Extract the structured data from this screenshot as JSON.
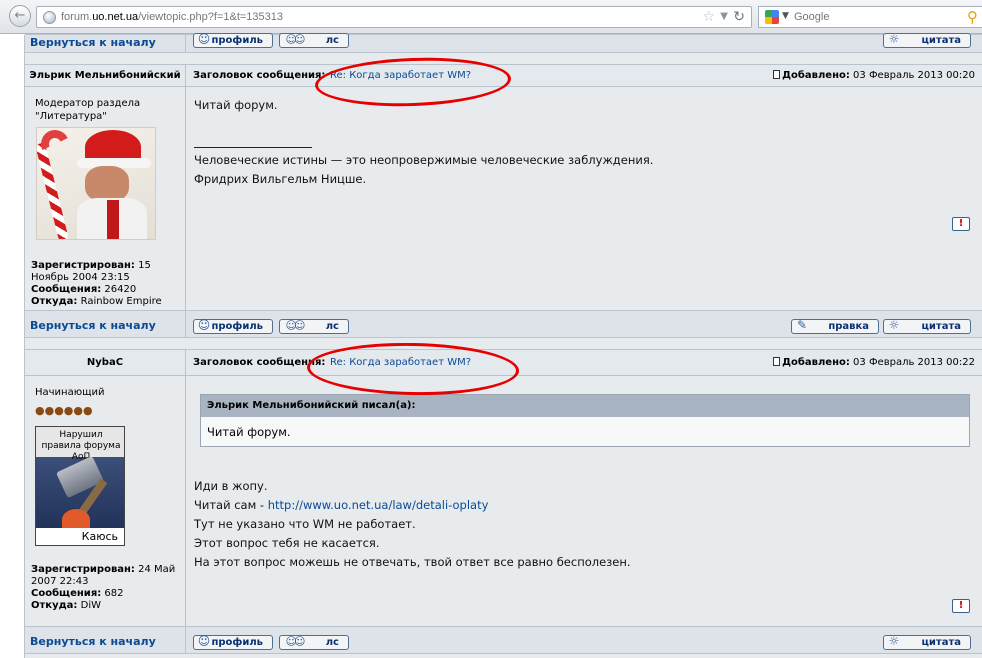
{
  "browser": {
    "url_prefix": "forum.",
    "url_domain": "uo.net.ua",
    "url_path": "/viewtopic.php?f=1&t=135313",
    "search_placeholder": "Google",
    "back_icon": "back-arrow-icon",
    "colors": {
      "chrome_top": "#f4f5f7",
      "chrome_bottom": "#dfe3e8"
    }
  },
  "nav": {
    "back_to_top": "Вернуться к началу"
  },
  "buttons": {
    "profile": "профиль",
    "pm": "лс",
    "quote": "цитата",
    "edit": "правка"
  },
  "labels": {
    "subject": "Заголовок сообщения:",
    "posted": "Добавлено:",
    "registered": "Зарегистрирован:",
    "posts": "Сообщения:",
    "from": "Откуда:",
    "quote_wrote": "Эльрик Мельнибонийский писал(а):"
  },
  "posts": [
    {
      "author": "Эльрик Мельнибонийский",
      "rank": [
        "Модератор раздела",
        "\"Литература\""
      ],
      "subject": "Re: Когда заработает WM?",
      "date": "03 Февраль 2013 00:20",
      "registered_1": "15",
      "registered_2": "Ноябрь 2004 23:15",
      "posts_count": "26420",
      "location": "Rainbow Empire",
      "body": [
        "Читай форум."
      ],
      "signature": [
        "Человеческие истины — это неопровержимые человеческие заблуждения.",
        "Фридрих Вильгельм Ницше."
      ]
    },
    {
      "author": "NybaC",
      "rank": [
        "Начинающий"
      ],
      "rank_stars": "●●●●●●",
      "avatar_caption": "Нарушил правила форума АоП",
      "avatar_bottom": "Каюсь",
      "subject": "Re: Когда заработает WM?",
      "date": "03 Февраль 2013 00:22",
      "registered_1": "24 Май",
      "registered_2": "2007 22:43",
      "posts_count": "682",
      "location": "DiW",
      "quote_text": "Читай форум.",
      "body": [
        "Иди в жопу.",
        "Читай сам - ",
        "Тут не указано что WM не работает.",
        "Этот вопрос тебя не касается.",
        "На этот вопрос можешь не отвечать, твой ответ все равно бесполезен."
      ],
      "link": "http://www.uo.net.ua/law/detali-oplaty"
    }
  ],
  "annotation_color": "#e60000"
}
